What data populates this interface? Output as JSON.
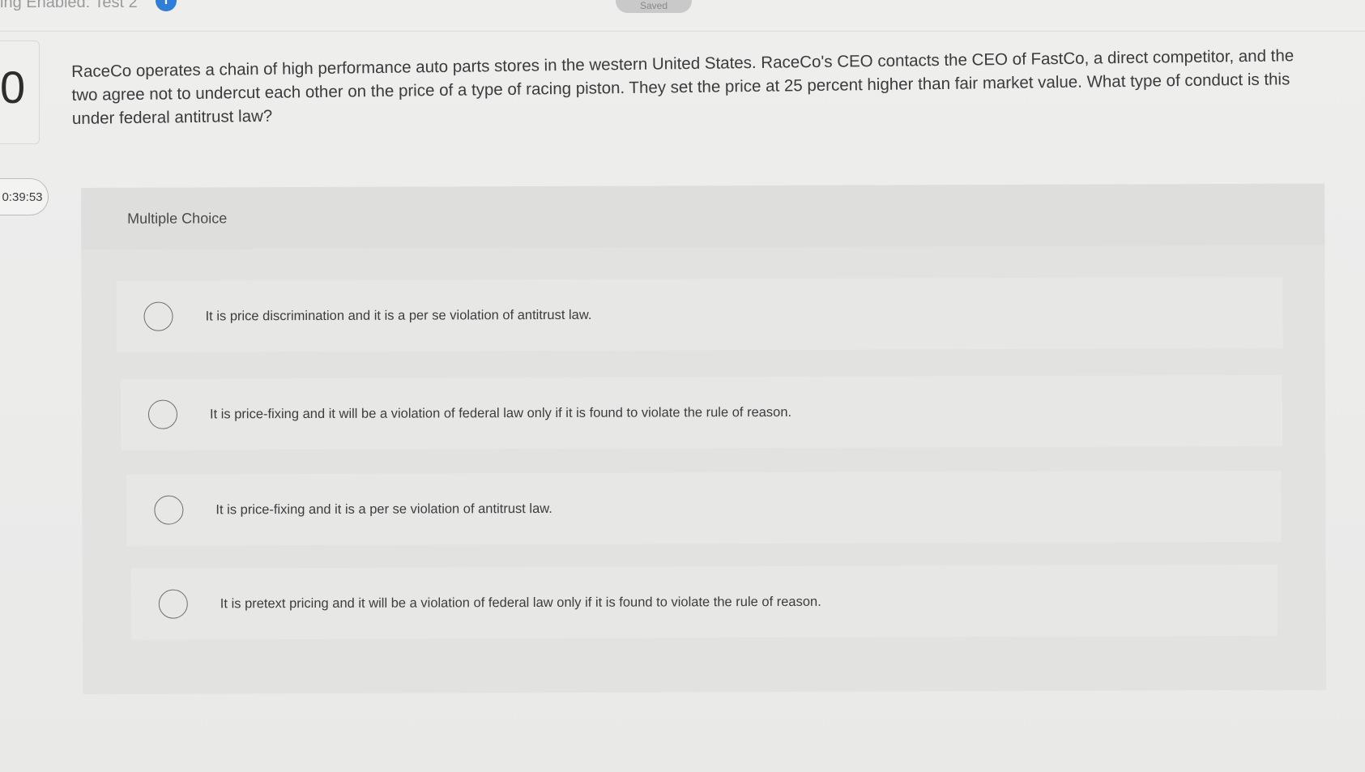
{
  "header": {
    "title": "ing Enabled: Test 2",
    "info_icon": "i",
    "saved_label": "Saved"
  },
  "question": {
    "number": "0",
    "timer": "0:39:53",
    "text": "RaceCo operates a chain of high performance auto parts stores in the western United States. RaceCo's CEO contacts the CEO of FastCo, a direct competitor, and the two agree not to undercut each other on the price of a type of racing piston. They set the price at 25 percent higher than fair market value. What type of conduct is this under federal antitrust law?"
  },
  "choices": {
    "type_label": "Multiple Choice",
    "options": [
      {
        "label": "It is price discrimination and it is a per se violation of antitrust law.",
        "selected": false
      },
      {
        "label": "It is price-fixing and it will be a violation of federal law only if it is found to violate the rule of reason.",
        "selected": false
      },
      {
        "label": "It is price-fixing and it is a per se violation of antitrust law.",
        "selected": false
      },
      {
        "label": "It is pretext pricing and it will be a violation of federal law only if it is found to violate the rule of reason.",
        "selected": false
      }
    ]
  },
  "icons": {
    "info": "info-icon",
    "radio": "radio-button-icon"
  },
  "colors": {
    "background": "#ececeb",
    "panel": "#e2e2e1",
    "option": "#e7e7e6",
    "info_blue": "#2f7fd9",
    "text": "#3b3b3b"
  }
}
